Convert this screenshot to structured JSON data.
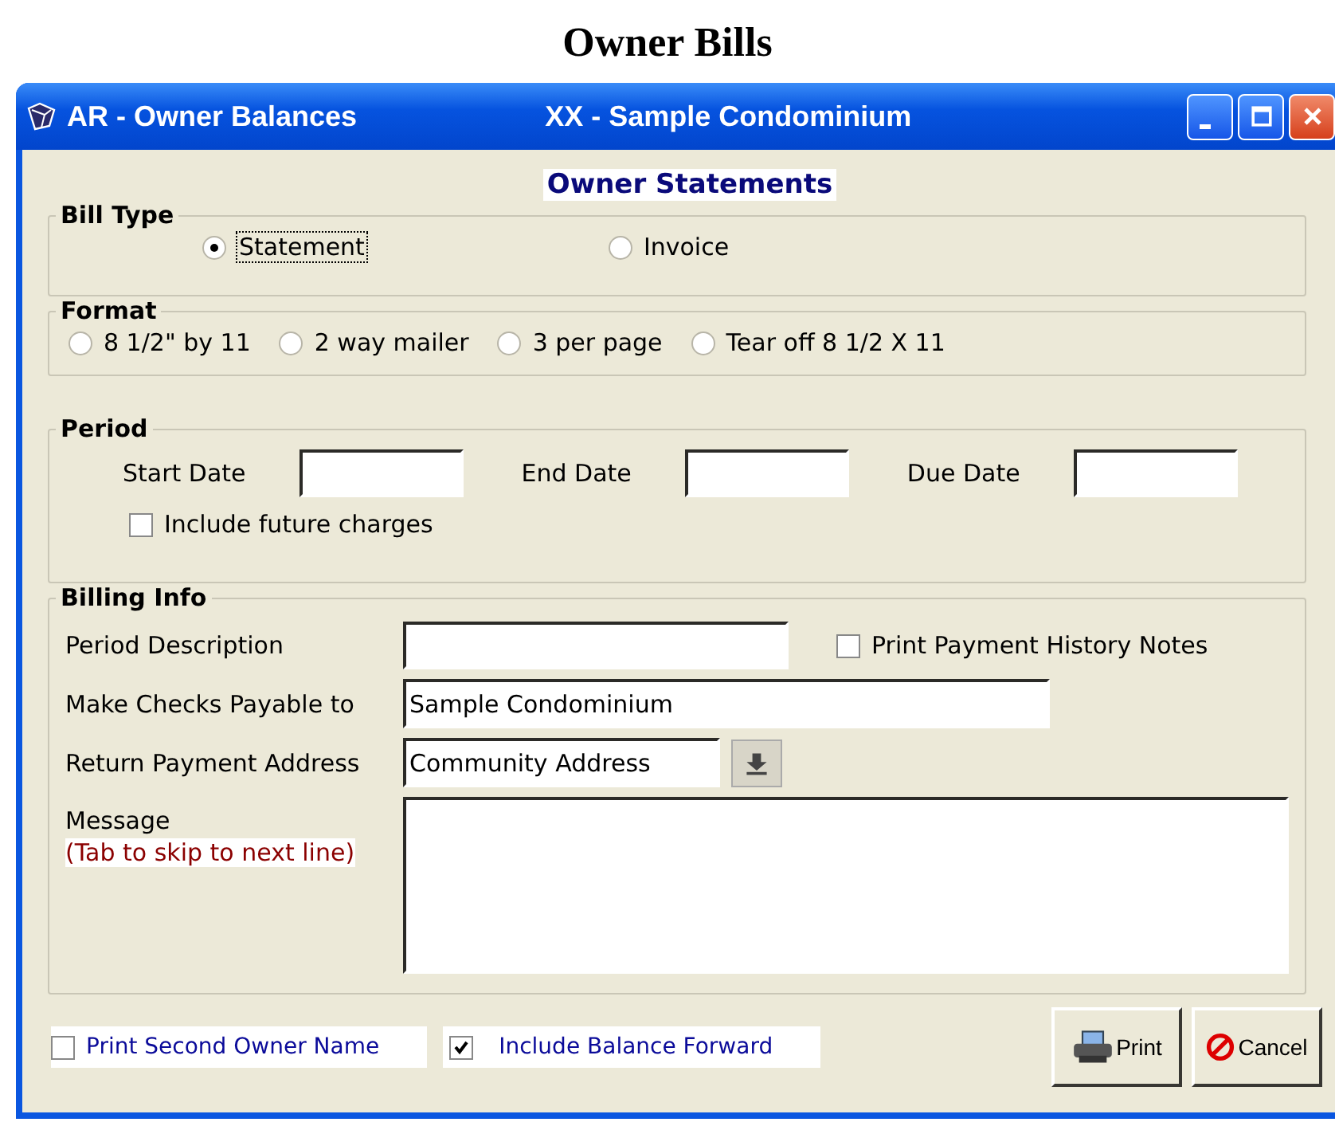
{
  "page_title": "Owner Bills",
  "window": {
    "title": "AR - Owner Balances",
    "subtitle": "XX  - Sample Condominium"
  },
  "heading": "Owner Statements",
  "bill_type": {
    "label": "Bill Type",
    "options": [
      {
        "label": "Statement",
        "selected": true
      },
      {
        "label": "Invoice",
        "selected": false
      }
    ]
  },
  "format": {
    "label": "Format",
    "options": [
      {
        "label": "8 1/2\" by 11",
        "selected": false
      },
      {
        "label": "2 way mailer",
        "selected": false
      },
      {
        "label": "3 per page",
        "selected": false
      },
      {
        "label": "Tear off 8 1/2 X 11",
        "selected": false
      }
    ]
  },
  "period": {
    "label": "Period",
    "dates": [
      {
        "label": "Start Date"
      },
      {
        "label": "End Date"
      },
      {
        "label": "Due Date"
      }
    ],
    "include_future_charges": {
      "label": "Include future charges",
      "checked": false
    }
  },
  "billing_info": {
    "label": "Billing Info",
    "period_description": {
      "label": "Period Description"
    },
    "print_history_notes": {
      "label": "Print Payment History Notes",
      "checked": false
    },
    "payable_to": {
      "label": "Make Checks Payable to",
      "value": "Sample Condominium"
    },
    "return_address": {
      "label": "Return Payment Address",
      "value": "Community Address"
    },
    "message": {
      "label": "Message",
      "hint": "(Tab to skip to next line)"
    }
  },
  "options": [
    {
      "label": "Print Second Owner Name",
      "checked": false
    },
    {
      "label": "Include Balance Forward",
      "checked": true
    }
  ],
  "buttons": [
    {
      "label": "Print",
      "kind": "print"
    },
    {
      "label": "Cancel",
      "kind": "cancel"
    }
  ]
}
